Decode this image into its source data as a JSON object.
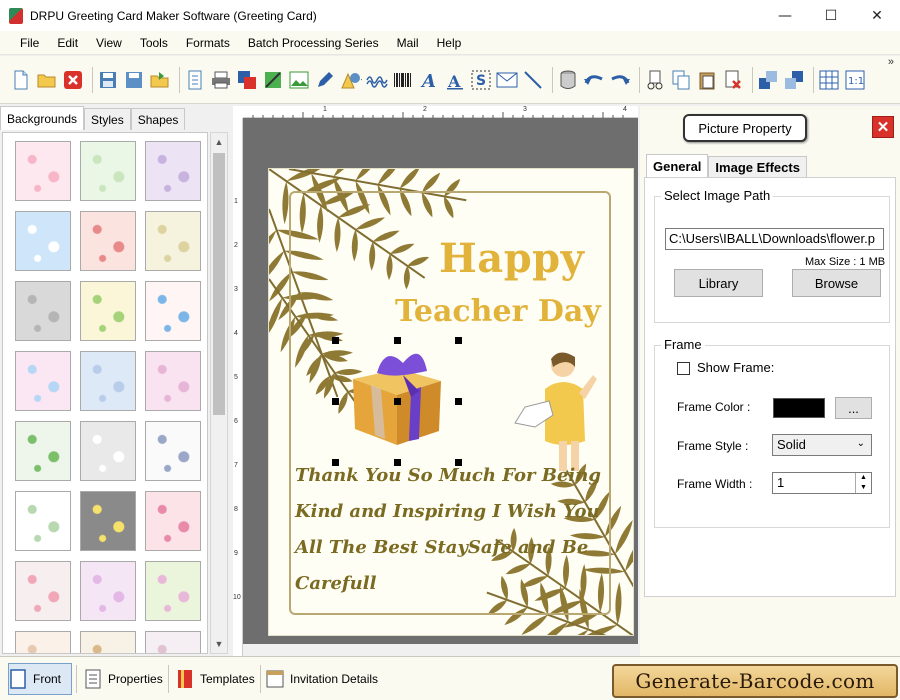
{
  "window": {
    "title": "DRPU Greeting Card Maker Software (Greeting Card)",
    "minimize": "—",
    "maximize": "☐",
    "close": "✕"
  },
  "menu": [
    "File",
    "Edit",
    "View",
    "Tools",
    "Formats",
    "Batch Processing Series",
    "Mail",
    "Help"
  ],
  "toolbar": {
    "overflow": "»"
  },
  "left_panel": {
    "tabs": [
      "Backgrounds",
      "Styles",
      "Shapes"
    ],
    "active_tab": "Backgrounds",
    "thumbnail_count": 24
  },
  "card": {
    "title_line1": "Happy",
    "title_line2": "Teacher Day",
    "message": [
      "Thank You So Much For Being",
      "Kind and Inspiring I Wish You",
      "All The Best StaySafe and Be",
      "Carefull"
    ],
    "colors": {
      "title": "#e2b33a",
      "message": "#7a6a22",
      "leaf": "#7c6314",
      "frame": "#b9a871"
    }
  },
  "ruler": {
    "top_labels": [
      "1",
      "2",
      "3",
      "4"
    ],
    "left_labels": [
      "1",
      "2",
      "3",
      "4",
      "5",
      "6",
      "7",
      "8",
      "9",
      "10"
    ]
  },
  "right_panel": {
    "property_button": "Picture Property",
    "close_label": "✕",
    "tabs": [
      "General",
      "Image Effects"
    ],
    "active_tab": "General",
    "image_path_group": "Select Image Path",
    "image_path": "C:\\Users\\IBALL\\Downloads\\flower.p",
    "max_size": "Max Size : 1 MB",
    "library_button": "Library",
    "browse_button": "Browse",
    "frame_group": "Frame",
    "show_frame_label": "Show Frame:",
    "show_frame_checked": false,
    "frame_color_label": "Frame Color :",
    "frame_color": "#000000",
    "frame_color_button": "...",
    "frame_style_label": "Frame Style :",
    "frame_style": "Solid",
    "frame_width_label": "Frame Width :",
    "frame_width": "1"
  },
  "bottom_tabs": [
    "Front",
    "Properties",
    "Templates",
    "Invitation Details"
  ],
  "active_bottom_tab": "Front",
  "brand": "Generate-Barcode.com"
}
